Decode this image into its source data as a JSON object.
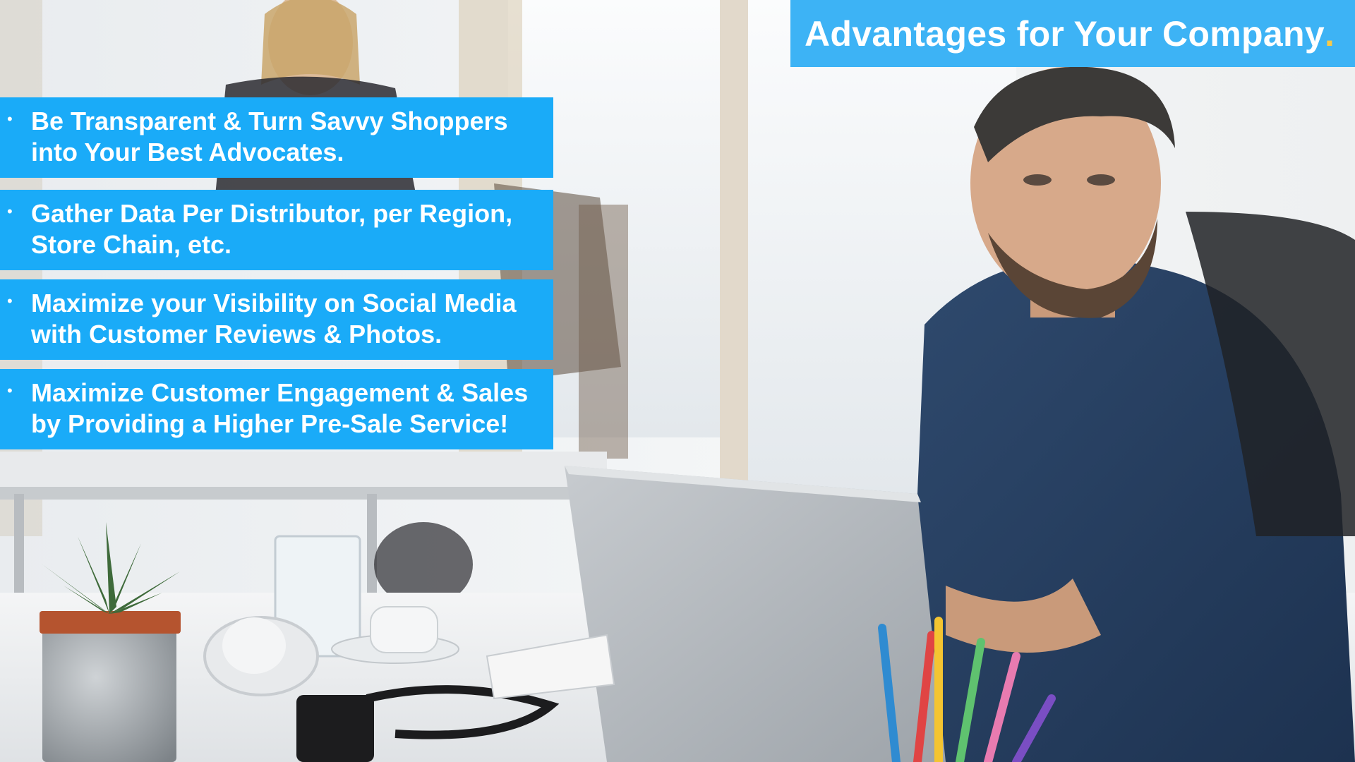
{
  "title": {
    "text": "Advantages for Your Company",
    "dot": "."
  },
  "bullets": [
    {
      "symbol": "•",
      "text": "Be Transparent & Turn Savvy Shoppers\ninto Your Best Advocates."
    },
    {
      "symbol": "•",
      "text": "Gather Data Per Distributor, per Region,\nStore Chain, etc."
    },
    {
      "symbol": "•",
      "text": "Maximize your Visibility on Social Media\nwith Customer Reviews & Photos."
    },
    {
      "symbol": "•",
      "text": "Maximize Customer Engagement & Sales\nby Providing a Higher Pre-Sale Service!"
    }
  ],
  "colors": {
    "title_bar": "#3db3f5",
    "bullet_box": "#1aabf8",
    "title_dot": "#f7c948",
    "text": "#ffffff"
  }
}
